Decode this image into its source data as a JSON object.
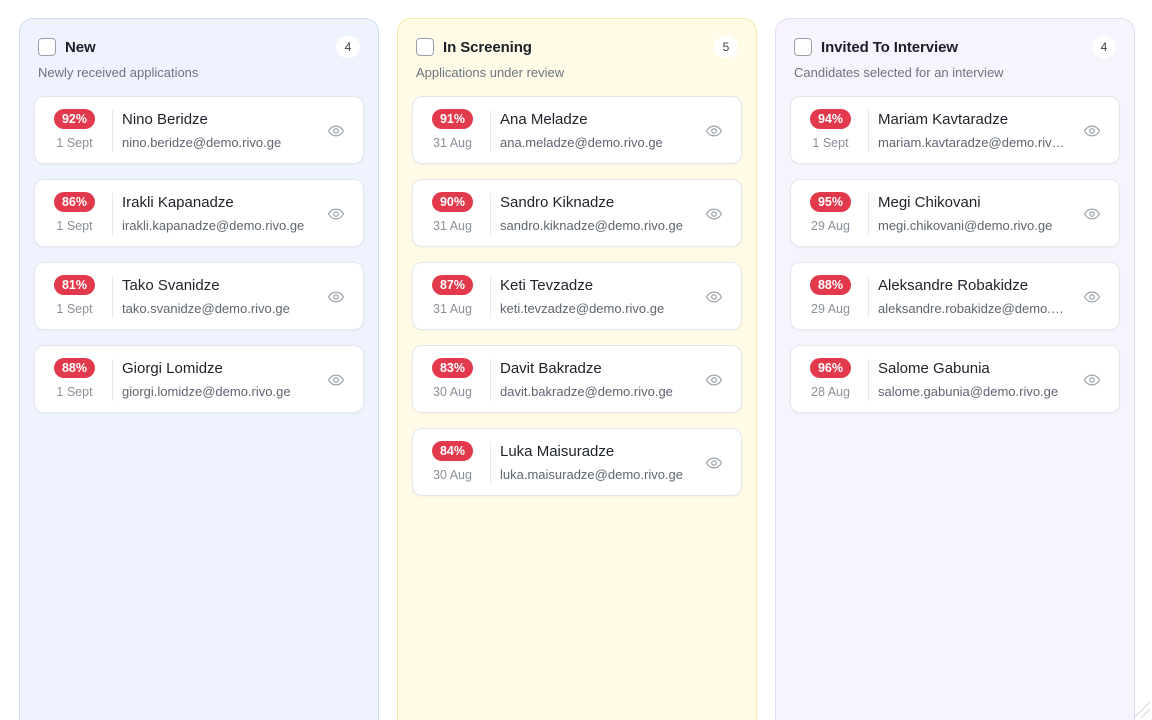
{
  "columns": [
    {
      "title": "New",
      "count": "4",
      "subtitle": "Newly received applications",
      "bg": "#eef3fd",
      "border": "#cfdcf4",
      "cards": [
        {
          "score": "92%",
          "date": "1 Sept",
          "name": "Nino Beridze",
          "email": "nino.beridze@demo.rivo.ge"
        },
        {
          "score": "86%",
          "date": "1 Sept",
          "name": "Irakli Kapanadze",
          "email": "irakli.kapanadze@demo.rivo.ge"
        },
        {
          "score": "81%",
          "date": "1 Sept",
          "name": "Tako Svanidze",
          "email": "tako.svanidze@demo.rivo.ge"
        },
        {
          "score": "88%",
          "date": "1 Sept",
          "name": "Giorgi Lomidze",
          "email": "giorgi.lomidze@demo.rivo.ge"
        }
      ]
    },
    {
      "title": "In Screening",
      "count": "5",
      "subtitle": "Applications under review",
      "bg": "#fffbe6",
      "border": "#f6e7a8",
      "cards": [
        {
          "score": "91%",
          "date": "31 Aug",
          "name": "Ana Meladze",
          "email": "ana.meladze@demo.rivo.ge"
        },
        {
          "score": "90%",
          "date": "31 Aug",
          "name": "Sandro Kiknadze",
          "email": "sandro.kiknadze@demo.rivo.ge"
        },
        {
          "score": "87%",
          "date": "31 Aug",
          "name": "Keti Tevzadze",
          "email": "keti.tevzadze@demo.rivo.ge"
        },
        {
          "score": "83%",
          "date": "30 Aug",
          "name": "Davit Bakradze",
          "email": "davit.bakradze@demo.rivo.ge"
        },
        {
          "score": "84%",
          "date": "30 Aug",
          "name": "Luka Maisuradze",
          "email": "luka.maisuradze@demo.rivo.ge"
        }
      ]
    },
    {
      "title": "Invited To Interview",
      "count": "4",
      "subtitle": "Candidates selected for an interview",
      "bg": "#f8f4fd",
      "border": "#e6dbf4",
      "cards": [
        {
          "score": "94%",
          "date": "1 Sept",
          "name": "Mariam Kavtaradze",
          "email": "mariam.kavtaradze@demo.rivo.ge"
        },
        {
          "score": "95%",
          "date": "29 Aug",
          "name": "Megi Chikovani",
          "email": "megi.chikovani@demo.rivo.ge"
        },
        {
          "score": "88%",
          "date": "29 Aug",
          "name": "Aleksandre Robakidze",
          "email": "aleksandre.robakidze@demo.rivo.ge"
        },
        {
          "score": "96%",
          "date": "28 Aug",
          "name": "Salome Gabunia",
          "email": "salome.gabunia@demo.rivo.ge"
        }
      ]
    }
  ],
  "colors": {
    "score_badge": "#e23a4c"
  },
  "icons": {
    "view": "eye-icon",
    "select": "checkbox"
  }
}
